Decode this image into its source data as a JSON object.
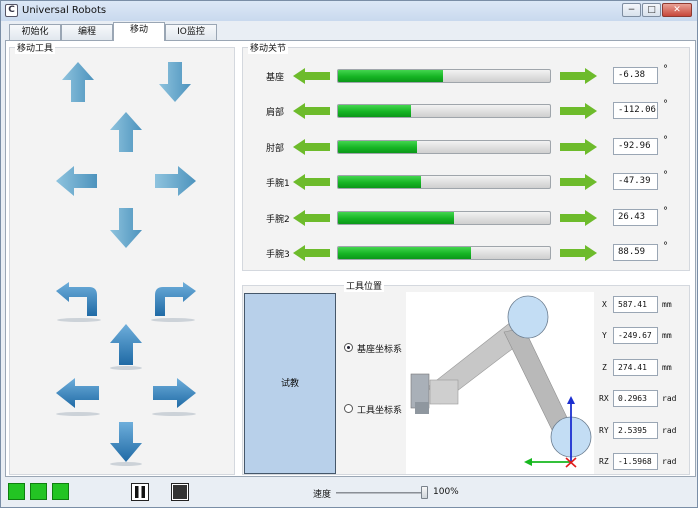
{
  "window": {
    "title": "Universal Robots",
    "app_icon": "C",
    "minimize": "−",
    "maximize": "□",
    "close": "✕"
  },
  "tabs": [
    {
      "label": "初始化",
      "active": false
    },
    {
      "label": "编程",
      "active": false
    },
    {
      "label": "移动",
      "active": true
    },
    {
      "label": "IO监控",
      "active": false
    }
  ],
  "move_tool": {
    "label": "移动工具"
  },
  "joints": {
    "label": "移动关节",
    "unit": "°",
    "items": [
      {
        "name": "基座",
        "value": "-6.38",
        "fill": 0.49
      },
      {
        "name": "肩部",
        "value": "-112.06",
        "fill": 0.34
      },
      {
        "name": "肘部",
        "value": "-92.96",
        "fill": 0.37
      },
      {
        "name": "手腕1",
        "value": "-47.39",
        "fill": 0.39
      },
      {
        "name": "手腕2",
        "value": "26.43",
        "fill": 0.54
      },
      {
        "name": "手腕3",
        "value": "88.59",
        "fill": 0.62
      }
    ]
  },
  "tool_position": {
    "label": "工具位置",
    "teach_label": "试教",
    "radio": [
      {
        "label": "基座坐标系",
        "selected": true
      },
      {
        "label": "工具坐标系",
        "selected": false
      }
    ],
    "coords": [
      {
        "axis": "X",
        "value": "587.41",
        "unit": "mm"
      },
      {
        "axis": "Y",
        "value": "-249.67",
        "unit": "mm"
      },
      {
        "axis": "Z",
        "value": "274.41",
        "unit": "mm"
      },
      {
        "axis": "RX",
        "value": "0.2963",
        "unit": "rad"
      },
      {
        "axis": "RY",
        "value": "2.5395",
        "unit": "rad"
      },
      {
        "axis": "RZ",
        "value": "-1.5968",
        "unit": "rad"
      }
    ]
  },
  "status": {
    "speed_label": "速度",
    "speed_value": "100%",
    "speed_fraction": 1.0
  },
  "colors": {
    "accent_green": "#16b524",
    "arrow_blue": "#5a9fcb",
    "led_green": "#23c423"
  },
  "icons": [
    "arrow-up-icon",
    "arrow-down-icon",
    "arrow-left-icon",
    "arrow-right-icon",
    "rotate-left-icon",
    "rotate-right-icon",
    "pause-icon",
    "stop-icon"
  ]
}
